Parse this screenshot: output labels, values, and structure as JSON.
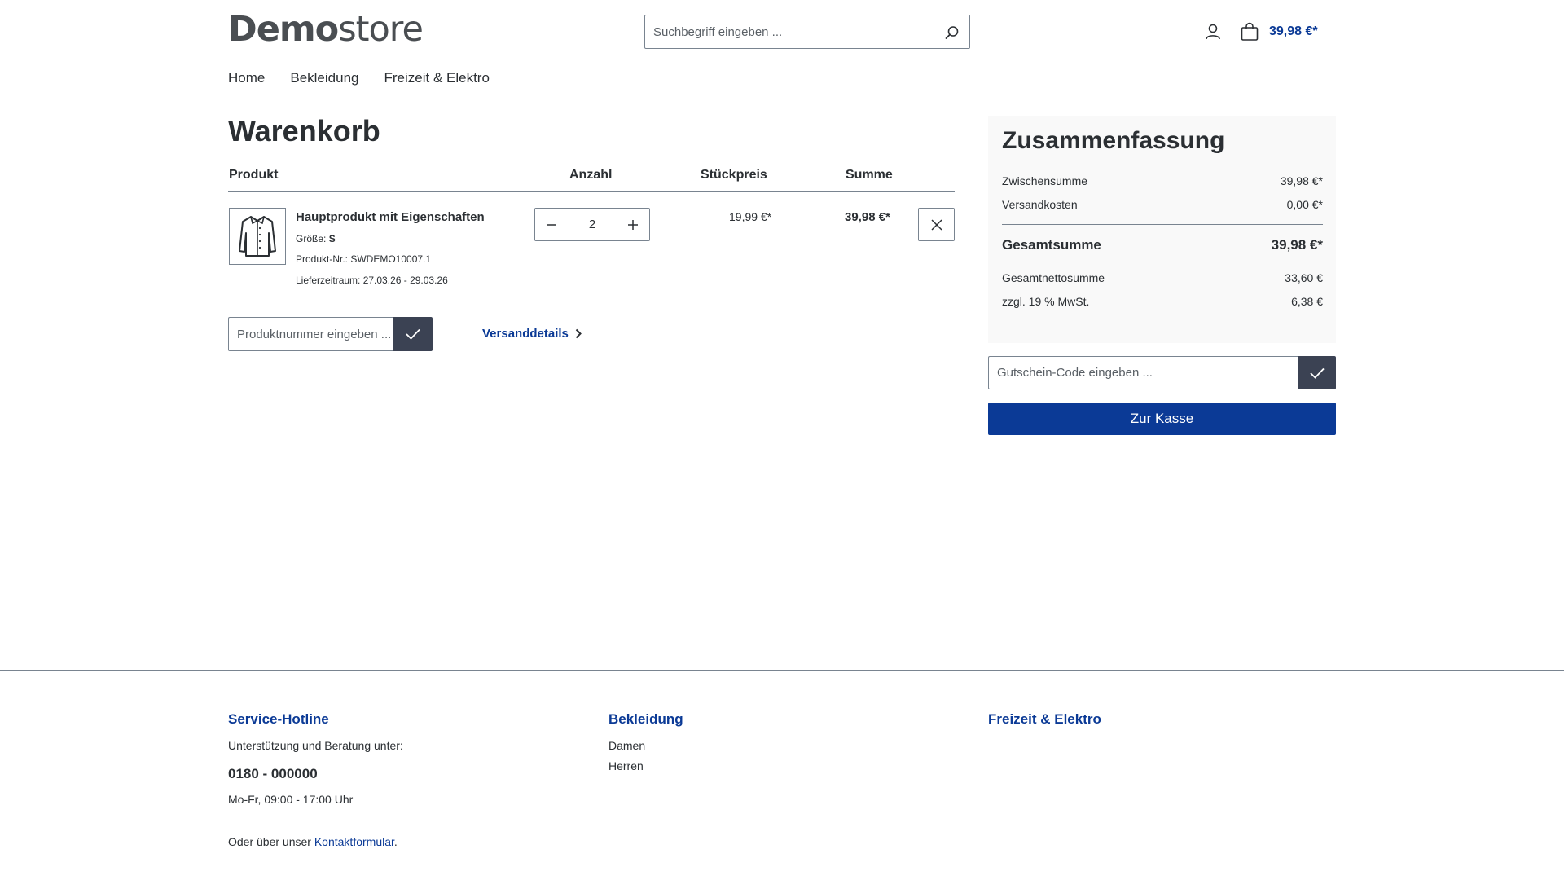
{
  "header": {
    "logo_bold": "Demo",
    "logo_light": "store",
    "search_placeholder": "Suchbegriff eingeben ...",
    "cart_total": "39,98 €*"
  },
  "nav": {
    "items": [
      "Home",
      "Bekleidung",
      "Freizeit & Elektro"
    ]
  },
  "cart": {
    "title": "Warenkorb",
    "columns": {
      "product": "Produkt",
      "quantity": "Anzahl",
      "unit_price": "Stückpreis",
      "sum": "Summe"
    },
    "items": [
      {
        "name": "Hauptprodukt mit Eigenschaften",
        "size_label": "Größe:",
        "size_value": "S",
        "product_number": "Produkt-Nr.: SWDEMO10007.1",
        "delivery": "Lieferzeitraum: 27.03.26 - 29.03.26",
        "quantity": "2",
        "unit_price": "19,99 €*",
        "sum": "39,98 €*"
      }
    ],
    "product_number_placeholder": "Produktnummer eingeben ...",
    "shipping_details": "Versanddetails"
  },
  "summary": {
    "title": "Zusammenfassung",
    "subtotal_label": "Zwischensumme",
    "subtotal_value": "39,98 €*",
    "shipping_label": "Versandkosten",
    "shipping_value": "0,00 €*",
    "total_label": "Gesamtsumme",
    "total_value": "39,98 €*",
    "net_label": "Gesamtnettosumme",
    "net_value": "33,60 €",
    "vat_label": "zzgl. 19 % MwSt.",
    "vat_value": "6,38 €",
    "voucher_placeholder": "Gutschein-Code eingeben ...",
    "checkout_label": "Zur Kasse"
  },
  "footer": {
    "hotline_heading": "Service-Hotline",
    "hotline_text": "Unterstützung und Beratung unter:",
    "hotline_number": "0180 - 000000",
    "hotline_hours": "Mo-Fr, 09:00 - 17:00 Uhr",
    "contact_prefix": "Oder über unser ",
    "contact_link": "Kontaktformular",
    "contact_suffix": ".",
    "clothing_heading": "Bekleidung",
    "clothing_links": [
      "Damen",
      "Herren"
    ],
    "leisure_heading": "Freizeit & Elektro"
  },
  "colors": {
    "accent": "#0b3a96",
    "dark_button": "#3b4253",
    "border": "#798490",
    "summary_bg": "#f9f9f9"
  }
}
